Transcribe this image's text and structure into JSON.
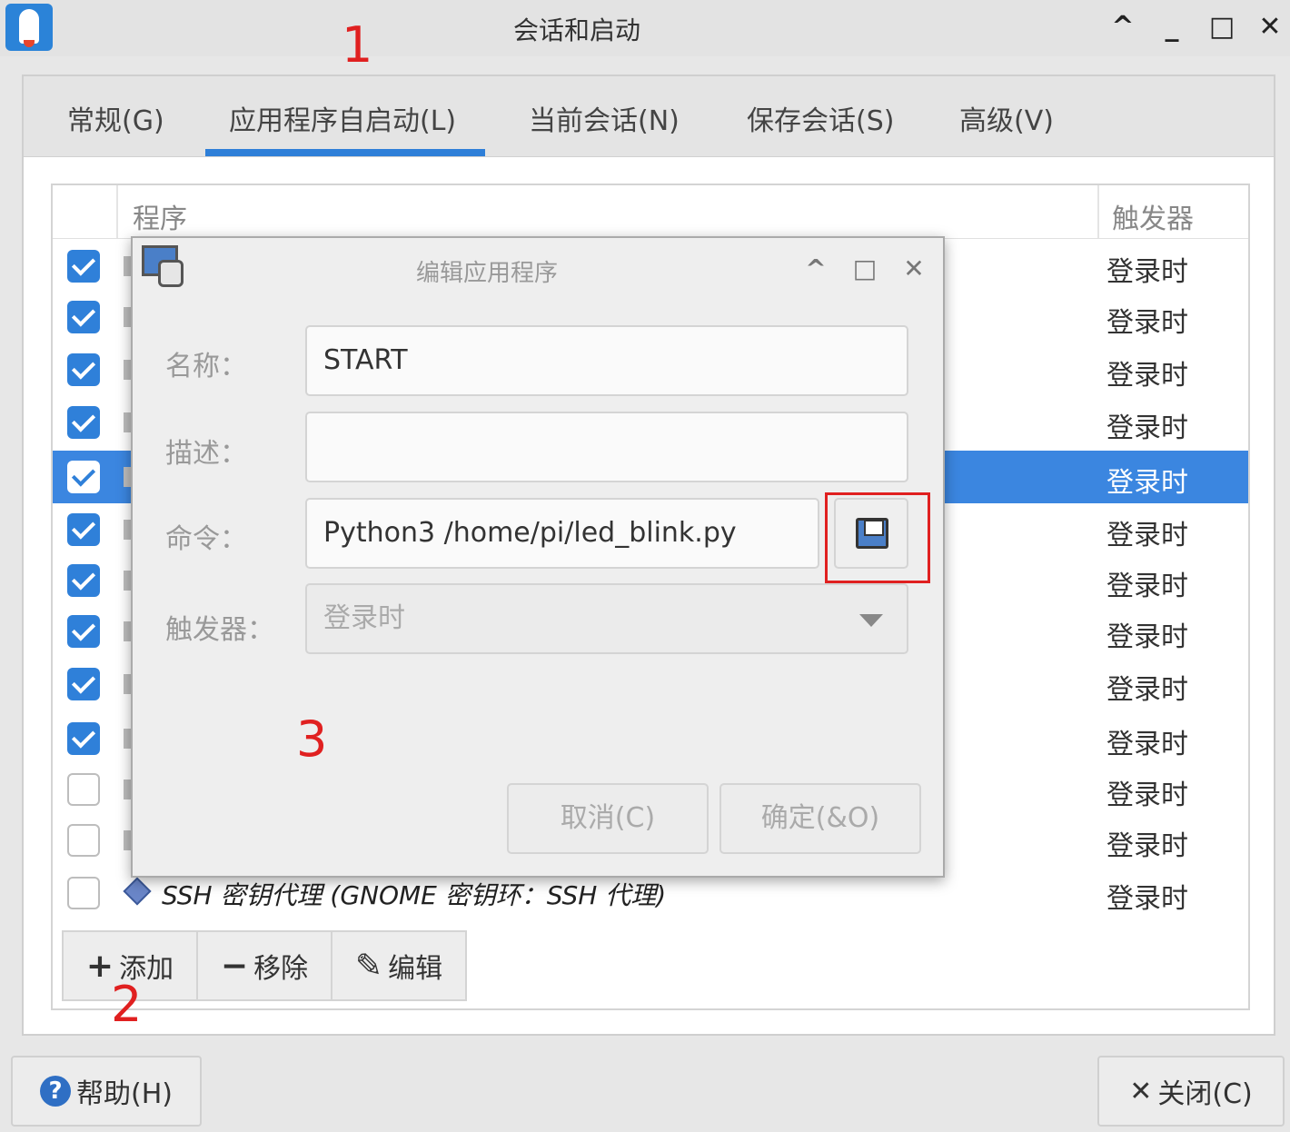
{
  "window": {
    "title": "会话和启动",
    "controls": {
      "shade": "^",
      "minimize": "_",
      "maximize": "□",
      "close": "✕"
    }
  },
  "tabs": [
    {
      "label": "常规(G)",
      "active": false
    },
    {
      "label": "应用程序自启动(L)",
      "active": true
    },
    {
      "label": "当前会话(N)",
      "active": false
    },
    {
      "label": "保存会话(S)",
      "active": false
    },
    {
      "label": "高级(V)",
      "active": false
    }
  ],
  "list": {
    "columns": {
      "program": "程序",
      "trigger": "触发器"
    },
    "rows": [
      {
        "checked": true,
        "trigger": "登录时",
        "selected": false
      },
      {
        "checked": true,
        "trigger": "登录时",
        "selected": false
      },
      {
        "checked": true,
        "trigger": "登录时",
        "selected": false
      },
      {
        "checked": true,
        "trigger": "登录时",
        "selected": false
      },
      {
        "checked": true,
        "trigger": "登录时",
        "selected": true
      },
      {
        "checked": true,
        "trigger": "登录时",
        "selected": false
      },
      {
        "checked": true,
        "trigger": "登录时",
        "selected": false
      },
      {
        "checked": true,
        "trigger": "登录时",
        "selected": false
      },
      {
        "checked": true,
        "trigger": "登录时",
        "selected": false
      },
      {
        "checked": true,
        "trigger": "登录时",
        "selected": false
      },
      {
        "checked": false,
        "trigger": "登录时",
        "selected": false
      },
      {
        "checked": false,
        "trigger": "登录时",
        "selected": false
      },
      {
        "checked": false,
        "trigger": "登录时",
        "selected": false,
        "program": "SSH 密钥代理 (GNOME 密钥环：SSH 代理)"
      }
    ]
  },
  "toolbar": {
    "add": "添加",
    "remove": "移除",
    "edit": "编辑"
  },
  "footer": {
    "help": "帮助(H)",
    "close": "关闭(C)"
  },
  "dialog": {
    "title": "编辑应用程序",
    "name_label": "名称：",
    "name_value": "START",
    "desc_label": "描述：",
    "desc_value": "",
    "cmd_label": "命令：",
    "cmd_value": "Python3  /home/pi/led_blink.py",
    "trigger_label": "触发器：",
    "trigger_value": "登录时",
    "cancel": "取消(C)",
    "ok": "确定(&O)"
  },
  "annotations": {
    "a1": "1",
    "a2": "2",
    "a3": "3"
  },
  "colors": {
    "accent": "#2e7fd8",
    "selected_row": "#3b86e0",
    "annotation": "#e02020"
  }
}
